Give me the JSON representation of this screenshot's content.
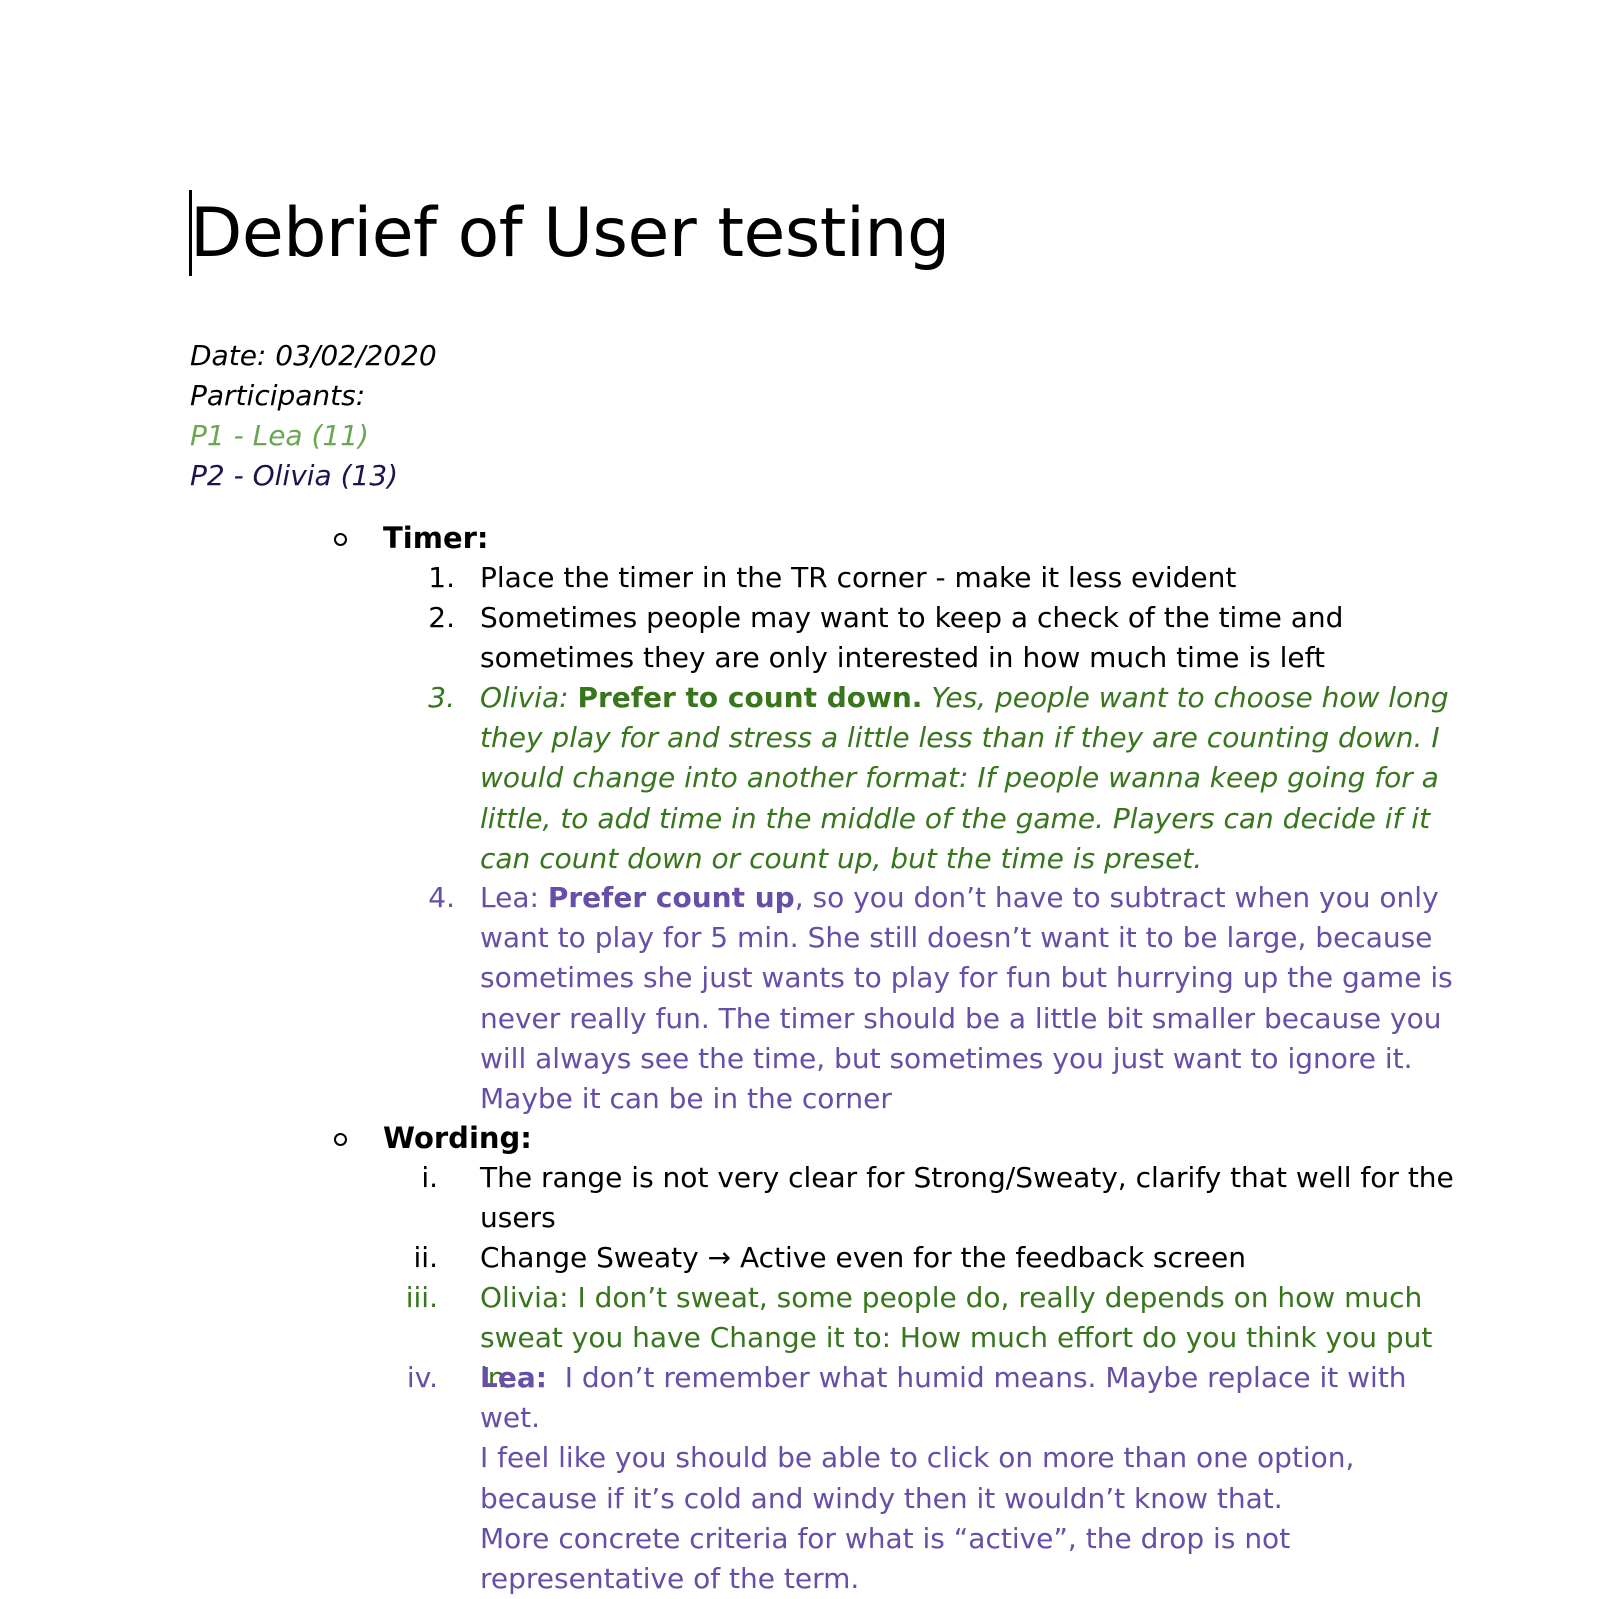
{
  "doc": {
    "title": "Debrief of User testing",
    "date": "Date: 03/02/2020",
    "participants_label": "Participants:",
    "p1": "P1 - Lea (11)",
    "p2": "P2 - Olivia (13)"
  },
  "colors": {
    "lea_participant": "#6aa84f",
    "olivia_participant": "#20124d",
    "olivia_notes": "#38761d",
    "lea_notes": "#674ea7"
  },
  "timer": {
    "heading": "Timer:",
    "items": [
      {
        "marker": "1.",
        "text": "Place the timer in the TR corner - make it less evident"
      },
      {
        "marker": "2.",
        "text": "Sometimes people may want to keep a check of the time and sometimes they are only interested in how much time is left"
      },
      {
        "marker": "3.",
        "speaker": "Olivia:",
        "bold": "Prefer to count down.",
        "text": "Yes, people want to choose how long they play for and stress a little less than if they are counting down. I would change into another format: If people wanna keep going for a little, to add time in the middle of the game. Players can decide if it can count down or count up, but the time is preset."
      },
      {
        "marker": "4.",
        "speaker": "Lea:",
        "bold": "Prefer count up",
        "text": ", so you don’t have to subtract when you only want to play for 5 min. She still doesn’t want it to be large, because sometimes she just wants to play for fun but hurrying up the game is never really fun. The timer should be a little bit smaller because you will always see the time, but sometimes you just want to ignore it. Maybe it can be in the corner"
      }
    ]
  },
  "wording": {
    "heading": "Wording:",
    "items": [
      {
        "marker": "i.",
        "text": "The range is not very clear for Strong/Sweaty, clarify that well for the users"
      },
      {
        "marker": "ii.",
        "text": "Change Sweaty → Active even for the feedback screen"
      },
      {
        "marker": "iii.",
        "text": "Olivia: I don’t sweat, some people do, really depends on how much sweat you have Change it to: How much effort do you think you put in"
      },
      {
        "marker": "iv.",
        "speaker": "Lea:",
        "line1": "I don’t remember what humid means. Maybe replace it with wet.",
        "line2": "I feel like you should be able to click on more than one option, because if it’s cold and windy then it wouldn’t know that.",
        "line3": "More concrete criteria for what is “active”, the drop is not representative of the term."
      }
    ]
  }
}
